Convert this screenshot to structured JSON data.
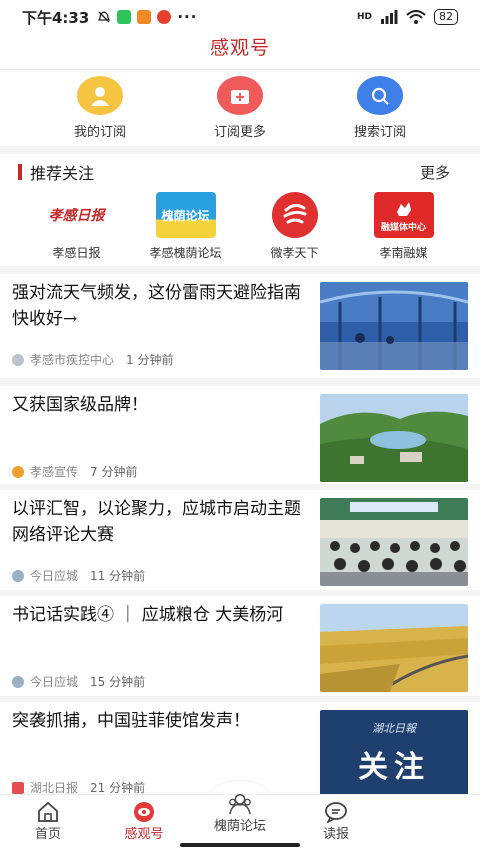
{
  "status_bar": {
    "time": "下午4:33",
    "network": "HD",
    "battery": "82"
  },
  "header": {
    "title": "感观号"
  },
  "actions": [
    {
      "label": "我的订阅",
      "color": "#f5c542",
      "icon": "user-icon"
    },
    {
      "label": "订阅更多",
      "color": "#ef5a5a",
      "icon": "add-subscription-icon"
    },
    {
      "label": "搜索订阅",
      "color": "#3f7fe8",
      "icon": "search-icon"
    }
  ],
  "recommend": {
    "title": "推荐关注",
    "more": "更多",
    "items": [
      {
        "name": "孝感日报",
        "logo_text": "孝感日报",
        "color": "#ffffff"
      },
      {
        "name": "孝感槐荫论坛",
        "logo_text": "槐荫论坛",
        "color": "#2aa0e0"
      },
      {
        "name": "微孝天下",
        "logo_text": "",
        "color": "#e03030"
      },
      {
        "name": "孝南融媒",
        "logo_text": "融媒体中心",
        "color": "#e02a2a"
      }
    ]
  },
  "news": [
    {
      "title": "强对流天气频发，这份雷雨天避险指南快收好→",
      "source": "孝感市疾控中心",
      "ago": "1 分钟前",
      "thumb": "rain"
    },
    {
      "title": "又获国家级品牌！",
      "source": "孝感宣传",
      "ago": "7 分钟前",
      "thumb": "lake"
    },
    {
      "title": "以评汇智，以论聚力，应城市启动主题网络评论大赛",
      "source": "今日应城",
      "ago": "11 分钟前",
      "thumb": "meeting"
    },
    {
      "title": "书记话实践④ ｜ 应城粮仓 大美杨河",
      "source": "今日应城",
      "ago": "15 分钟前",
      "thumb": "field"
    },
    {
      "title": "突袭抓捕，中国驻菲使馆发声！",
      "source": "湖北日报",
      "ago": "21 分钟前",
      "thumb": "focus",
      "thumb_top": "湖北日報",
      "thumb_main": "关注"
    }
  ],
  "nav": [
    {
      "label": "首页",
      "icon": "home-icon"
    },
    {
      "label": "感观号",
      "icon": "eye-icon"
    },
    {
      "label": "槐荫论坛",
      "icon": "forum-icon"
    },
    {
      "label": "读报",
      "icon": "chat-icon"
    }
  ]
}
